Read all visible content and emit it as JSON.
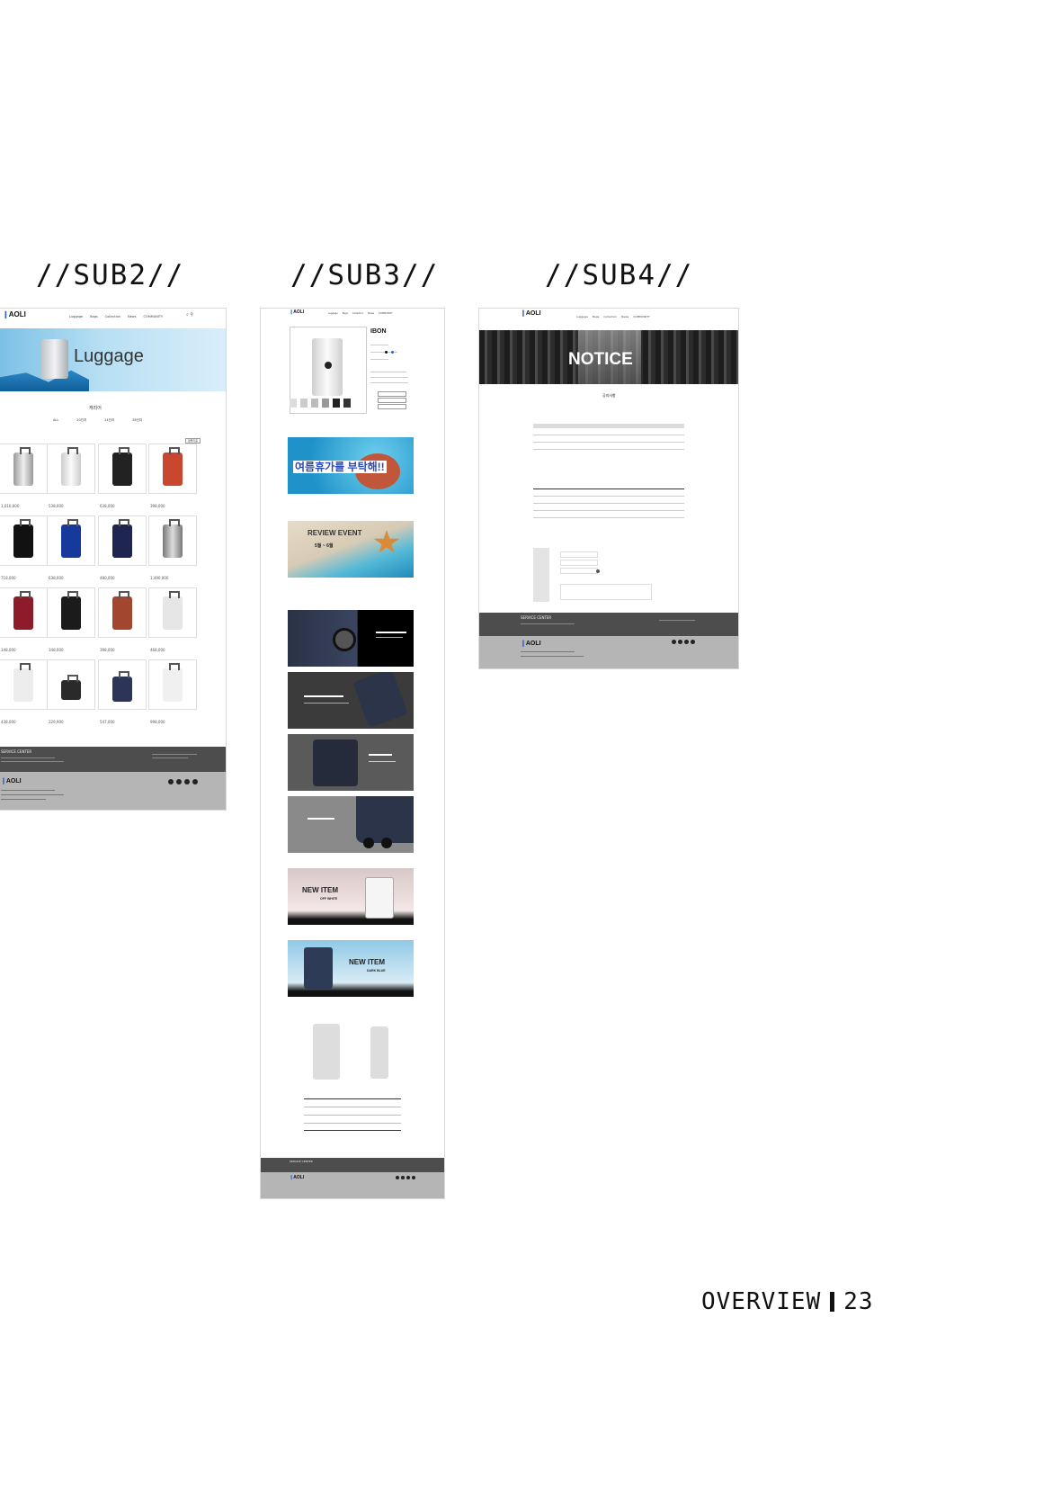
{
  "section_labels": {
    "sub2": "//SUB2//",
    "sub3": "//SUB3//",
    "sub4": "//SUB4//"
  },
  "brand": {
    "logo_text": "AOLI",
    "accent": "#2f63c8"
  },
  "nav_items": [
    "Luggage",
    "Bags",
    "Collection",
    "News",
    "COMMUNITY"
  ],
  "sub2": {
    "hero_title": "Luggage",
    "category_title": "캐리어",
    "filter_tabs": [
      "ALL",
      "20인치",
      "24인치",
      "28인치"
    ],
    "sort_label": "정렬기준",
    "price_rows": [
      [
        "1,010,000",
        "538,000",
        "638,000",
        "398,000"
      ],
      [
        "718,000",
        "638,000",
        "480,000",
        "1,490,000"
      ],
      [
        "348,000",
        "348,000",
        "398,000",
        "468,000"
      ],
      [
        "438,000",
        "229,900",
        "547,000",
        "998,000"
      ]
    ],
    "footer_title": "SERVICE CENTER"
  },
  "sub3": {
    "product_name": "IBON",
    "banners": [
      {
        "title": "여름휴가를 부탁해!!"
      },
      {
        "title": "REVIEW EVENT",
        "sub": "5월 ~ 6월"
      },
      {
        "title": "",
        "sub": ""
      },
      {
        "title": "",
        "sub": ""
      },
      {
        "title": "",
        "sub": ""
      },
      {
        "title": "",
        "sub": ""
      },
      {
        "title": "NEW ITEM",
        "sub": "OFF WHITE"
      },
      {
        "title": "NEW ITEM",
        "sub": "DARK BLUE"
      }
    ],
    "footer_title": "SERVICE CENTER"
  },
  "sub4": {
    "hero_title": "NOTICE",
    "board_title": "공지사항",
    "footer_title": "SERVICE CENTER"
  },
  "page_footer": {
    "label": "OVERVIEW",
    "page_number": "23"
  }
}
